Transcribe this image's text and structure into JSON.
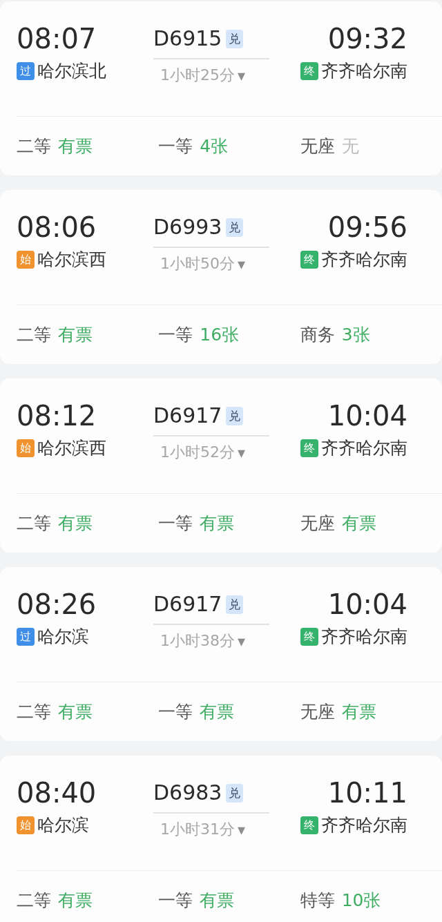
{
  "trains": [
    {
      "depart_time": "08:07",
      "train_no": "D6915",
      "exchange_badge": "兑",
      "arrive_time": "09:32",
      "from_badge": {
        "text": "过",
        "kind": "pass"
      },
      "from_station": "哈尔滨北",
      "duration": "1小时25分",
      "dropdown_icon": "▾",
      "to_badge": {
        "text": "终",
        "kind": "terminal"
      },
      "to_station": "齐齐哈尔南",
      "seats": [
        {
          "class": "二等",
          "status": "有票",
          "available": true
        },
        {
          "class": "一等",
          "status": "4张",
          "available": true
        },
        {
          "class": "无座",
          "status": "无",
          "available": false
        }
      ]
    },
    {
      "depart_time": "08:06",
      "train_no": "D6993",
      "exchange_badge": "兑",
      "arrive_time": "09:56",
      "from_badge": {
        "text": "始",
        "kind": "origin"
      },
      "from_station": "哈尔滨西",
      "duration": "1小时50分",
      "dropdown_icon": "▾",
      "to_badge": {
        "text": "终",
        "kind": "terminal"
      },
      "to_station": "齐齐哈尔南",
      "seats": [
        {
          "class": "二等",
          "status": "有票",
          "available": true
        },
        {
          "class": "一等",
          "status": "16张",
          "available": true
        },
        {
          "class": "商务",
          "status": "3张",
          "available": true
        }
      ]
    },
    {
      "depart_time": "08:12",
      "train_no": "D6917",
      "exchange_badge": "兑",
      "arrive_time": "10:04",
      "from_badge": {
        "text": "始",
        "kind": "origin"
      },
      "from_station": "哈尔滨西",
      "duration": "1小时52分",
      "dropdown_icon": "▾",
      "to_badge": {
        "text": "终",
        "kind": "terminal"
      },
      "to_station": "齐齐哈尔南",
      "seats": [
        {
          "class": "二等",
          "status": "有票",
          "available": true
        },
        {
          "class": "一等",
          "status": "有票",
          "available": true
        },
        {
          "class": "无座",
          "status": "有票",
          "available": true
        }
      ]
    },
    {
      "depart_time": "08:26",
      "train_no": "D6917",
      "exchange_badge": "兑",
      "arrive_time": "10:04",
      "from_badge": {
        "text": "过",
        "kind": "pass"
      },
      "from_station": "哈尔滨",
      "duration": "1小时38分",
      "dropdown_icon": "▾",
      "to_badge": {
        "text": "终",
        "kind": "terminal"
      },
      "to_station": "齐齐哈尔南",
      "seats": [
        {
          "class": "二等",
          "status": "有票",
          "available": true
        },
        {
          "class": "一等",
          "status": "有票",
          "available": true
        },
        {
          "class": "无座",
          "status": "有票",
          "available": true
        }
      ]
    },
    {
      "depart_time": "08:40",
      "train_no": "D6983",
      "exchange_badge": "兑",
      "arrive_time": "10:11",
      "from_badge": {
        "text": "始",
        "kind": "origin"
      },
      "from_station": "哈尔滨",
      "duration": "1小时31分",
      "dropdown_icon": "▾",
      "to_badge": {
        "text": "终",
        "kind": "terminal"
      },
      "to_station": "齐齐哈尔南",
      "seats": [
        {
          "class": "二等",
          "status": "有票",
          "available": true
        },
        {
          "class": "一等",
          "status": "有票",
          "available": true
        },
        {
          "class": "特等",
          "status": "10张",
          "available": true
        }
      ]
    }
  ]
}
